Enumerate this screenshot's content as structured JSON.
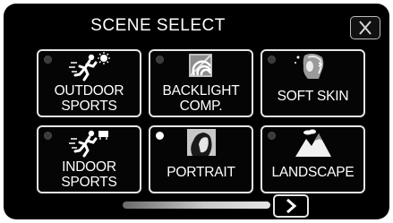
{
  "header": {
    "title": "SCENE SELECT"
  },
  "icons": {
    "close": "close-icon",
    "next": "chevron-right-icon"
  },
  "colors": {
    "background": "#000000",
    "tile_border": "#e6e6e6",
    "text": "#ffffff"
  },
  "scenes": [
    {
      "lines": [
        "OUTDOOR",
        "SPORTS"
      ],
      "icon": "outdoor-sports-icon",
      "selected": false
    },
    {
      "lines": [
        "BACKLIGHT",
        "COMP."
      ],
      "icon": "backlight-comp-icon",
      "selected": false
    },
    {
      "lines": [
        "SOFT SKIN"
      ],
      "icon": "soft-skin-icon",
      "selected": false
    },
    {
      "lines": [
        "INDOOR",
        "SPORTS"
      ],
      "icon": "indoor-sports-icon",
      "selected": false
    },
    {
      "lines": [
        "PORTRAIT"
      ],
      "icon": "portrait-icon",
      "selected": true
    },
    {
      "lines": [
        "LANDSCAPE"
      ],
      "icon": "landscape-icon",
      "selected": false
    }
  ],
  "pagination": {
    "scroll_progress": 0.5
  }
}
